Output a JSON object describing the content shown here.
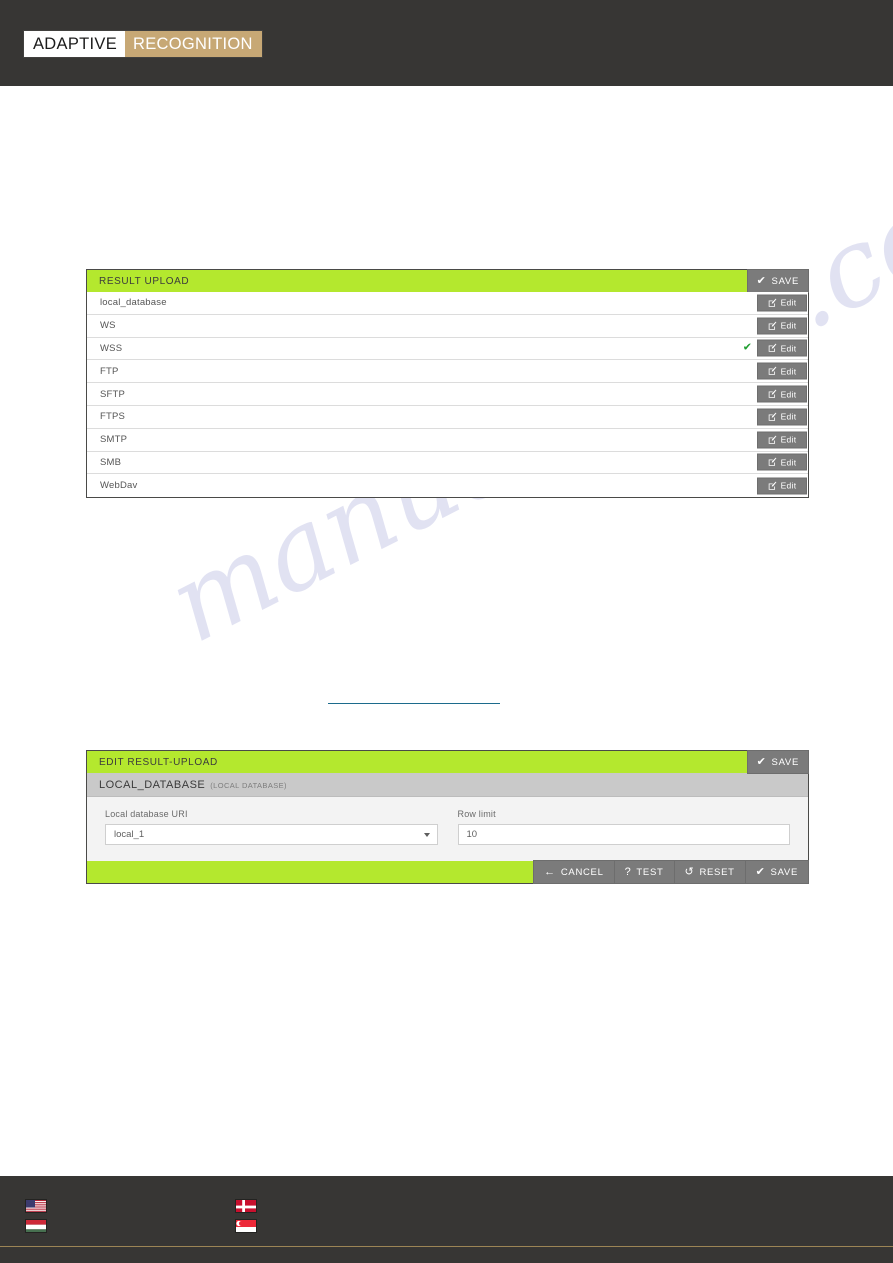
{
  "header": {
    "logo_left": "ADAPTIVE",
    "logo_right": "RECOGNITION",
    "logo_left_bg": "#ffffff",
    "logo_right_bg": "#c7a875",
    "bar_bg": "#373634"
  },
  "watermark": {
    "text": "manualshive.com"
  },
  "colors": {
    "accent_green": "#b4e82e",
    "button_grey": "#7b7b7b",
    "subheader_grey": "#c9c9c9",
    "check_green": "#1f9e30",
    "link_blue": "#1c6b8c",
    "footer_rule": "#9c8555"
  },
  "result_upload_panel": {
    "title": "RESULT UPLOAD",
    "save_label": "SAVE",
    "save_icon": "check-icon",
    "edit_label": "Edit",
    "edit_icon": "pencil-square-icon",
    "rows": [
      {
        "label": "local_database",
        "checked": false
      },
      {
        "label": "WS",
        "checked": false
      },
      {
        "label": "WSS",
        "checked": true
      },
      {
        "label": "FTP",
        "checked": false
      },
      {
        "label": "SFTP",
        "checked": false
      },
      {
        "label": "FTPS",
        "checked": false
      },
      {
        "label": "SMTP",
        "checked": false
      },
      {
        "label": "SMB",
        "checked": false
      },
      {
        "label": "WebDav",
        "checked": false
      }
    ]
  },
  "edit_upload_panel": {
    "title": "EDIT RESULT-UPLOAD",
    "save_label": "SAVE",
    "save_icon": "check-icon",
    "subheader_title": "LOCAL_DATABASE",
    "subheader_sub": "(LOCAL DATABASE)",
    "fields": {
      "uri": {
        "label": "Local database URI",
        "value": "local_1",
        "icon": "chevron-down-icon"
      },
      "row_limit": {
        "label": "Row limit",
        "value": "10"
      }
    },
    "footer_buttons": [
      {
        "label": "CANCEL",
        "icon": "arrow-left-icon",
        "glyph": "←"
      },
      {
        "label": "TEST",
        "icon": "question-icon",
        "glyph": "?"
      },
      {
        "label": "RESET",
        "icon": "undo-arrow-icon",
        "glyph": "↺"
      },
      {
        "label": "SAVE",
        "icon": "check-icon",
        "glyph": "✔"
      }
    ]
  },
  "footer": {
    "flags": [
      {
        "name": "flag-us",
        "country": "United States"
      },
      {
        "name": "flag-hu",
        "country": "Hungary"
      },
      {
        "name": "flag-dk",
        "country": "Denmark"
      },
      {
        "name": "flag-sg",
        "country": "Singapore"
      }
    ]
  }
}
